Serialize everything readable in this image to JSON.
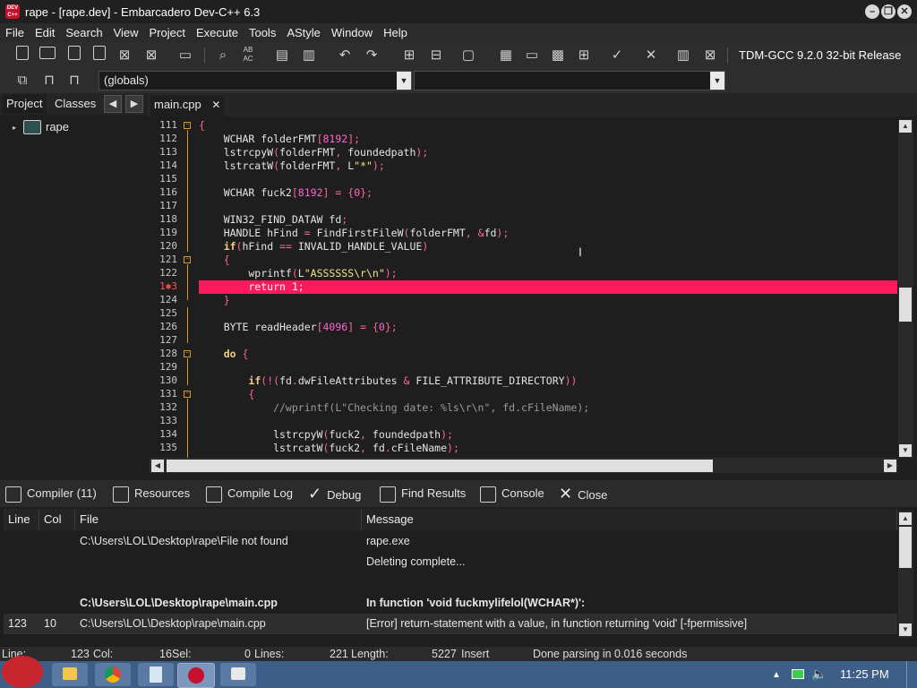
{
  "window": {
    "title": "rape - [rape.dev] - Embarcadero Dev-C++ 6.3",
    "app_icon_text": "DEV C++"
  },
  "menu": [
    "File",
    "Edit",
    "Search",
    "View",
    "Project",
    "Execute",
    "Tools",
    "AStyle",
    "Window",
    "Help"
  ],
  "toolbar": {
    "compiler": "TDM-GCC 9.2.0 32-bit Release"
  },
  "scope_combo": {
    "value": "(globals)"
  },
  "left_panel": {
    "tabs": [
      "Project",
      "Classes"
    ],
    "tree_root": "rape"
  },
  "editor": {
    "tab": "main.cpp",
    "error_line": 123
  },
  "bottom_tabs": [
    "Compiler (11)",
    "Resources",
    "Compile Log",
    "Debug",
    "Find Results",
    "Console",
    "Close"
  ],
  "results": {
    "headers": [
      "Line",
      "Col",
      "File",
      "Message"
    ],
    "rows": [
      {
        "line": "",
        "col": "",
        "file": "C:\\Users\\LOL\\Desktop\\rape\\File not found",
        "message": "rape.exe",
        "bold": false
      },
      {
        "line": "",
        "col": "",
        "file": "",
        "message": "Deleting complete...",
        "bold": false
      },
      {
        "line": "",
        "col": "",
        "file": "",
        "message": "",
        "bold": false
      },
      {
        "line": "",
        "col": "",
        "file": "C:\\Users\\LOL\\Desktop\\rape\\main.cpp",
        "message": "In function 'void fuckmylifelol(WCHAR*)':",
        "bold": true
      },
      {
        "line": "123",
        "col": "10",
        "file": "C:\\Users\\LOL\\Desktop\\rape\\main.cpp",
        "message": "[Error] return-statement with a value, in function returning 'void' [-fpermissive]",
        "bold": false
      }
    ]
  },
  "status": {
    "line_label": "Line:",
    "line_value": "123",
    "col_label": "Col:",
    "col_value": "16",
    "sel_label": "Sel:",
    "sel_value": "0",
    "lines_label": "Lines:",
    "lines_value": "221",
    "length_label": "Length:",
    "length_value": "5227",
    "mode": "Insert",
    "message": "Done parsing in 0.016 seconds"
  },
  "taskbar": {
    "clock": "11:25 PM"
  },
  "colors": {
    "error_line": "#ff1a5e",
    "fold_marker": "#d39a2b",
    "taskbar": "#3d5e86"
  }
}
